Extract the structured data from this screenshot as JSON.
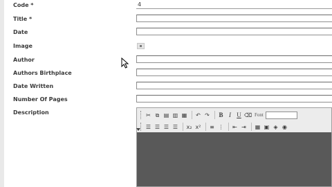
{
  "form": {
    "code": {
      "label": "Code *",
      "value": "4"
    },
    "title": {
      "label": "Title *",
      "value": ""
    },
    "date": {
      "label": "Date",
      "value": ""
    },
    "image": {
      "label": "Image"
    },
    "author": {
      "label": "Author",
      "value": ""
    },
    "authors_birthplace": {
      "label": "Authors Birthplace",
      "value": ""
    },
    "date_written": {
      "label": "Date Written",
      "value": ""
    },
    "number_of_pages": {
      "label": "Number Of Pages",
      "value": ""
    },
    "description": {
      "label": "Description"
    }
  },
  "editor": {
    "font_label": "Font",
    "toolbar_row1": [
      "cut-icon",
      "copy-icon",
      "paste-icon",
      "paste-text-icon",
      "paste-word-icon",
      "undo-icon",
      "redo-icon",
      "bold-icon",
      "italic-icon",
      "underline-icon",
      "clear-format-icon"
    ],
    "toolbar_row2": [
      "align-left-icon",
      "align-center-icon",
      "align-right-icon",
      "justify-icon",
      "subscript-icon",
      "superscript-icon",
      "ordered-list-icon",
      "unordered-list-icon",
      "outdent-icon",
      "indent-icon",
      "table-icon",
      "image-icon",
      "media-icon",
      "insert-object-icon"
    ]
  },
  "colors": {
    "editor_body": "#595959",
    "toolbar_bg": "#ececec",
    "label": "#3a3a3a"
  }
}
